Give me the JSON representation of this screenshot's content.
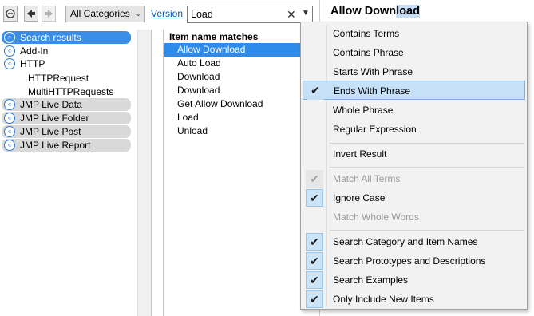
{
  "toolbar": {
    "category": "All Categories",
    "version_link": "Version",
    "search_value": "Load",
    "clear_glyph": "✕",
    "dropdown_glyph": "▼"
  },
  "tree": {
    "items": [
      {
        "label": "Search results",
        "icon": "search-icon"
      },
      {
        "label": "Add-In",
        "icon": "expand-icon"
      },
      {
        "label": "HTTP",
        "icon": "expand-icon"
      },
      {
        "label": "HTTPRequest"
      },
      {
        "label": "MultiHTTPRequests"
      },
      {
        "label": "JMP Live Data",
        "icon": "expand-icon"
      },
      {
        "label": "JMP Live Folder",
        "icon": "expand-icon"
      },
      {
        "label": "JMP Live Post",
        "icon": "expand-icon"
      },
      {
        "label": "JMP Live Report",
        "icon": "expand-icon"
      }
    ]
  },
  "list": {
    "header": "Item name matches",
    "items": [
      "Allow Download",
      "Auto Load",
      "Download",
      "Download",
      "Get Allow Download",
      "Load",
      "Unload"
    ]
  },
  "doc": {
    "title_pre": "Allow Down",
    "title_hl": "load"
  },
  "menu": {
    "items": [
      {
        "label": "Contains Terms",
        "checked": false,
        "disabled": false
      },
      {
        "label": "Contains Phrase",
        "checked": false,
        "disabled": false
      },
      {
        "label": "Starts With Phrase",
        "checked": false,
        "disabled": false
      },
      {
        "label": "Ends With Phrase",
        "checked": true,
        "disabled": false,
        "active": true
      },
      {
        "label": "Whole Phrase",
        "checked": false,
        "disabled": false
      },
      {
        "label": "Regular Expression",
        "checked": false,
        "disabled": false
      },
      {
        "label": "Invert Result",
        "checked": false,
        "disabled": false
      },
      {
        "label": "Match All Terms",
        "checked": true,
        "disabled": true
      },
      {
        "label": "Ignore Case",
        "checked": true,
        "disabled": false
      },
      {
        "label": "Match Whole Words",
        "checked": false,
        "disabled": true
      },
      {
        "label": "Search Category and Item Names",
        "checked": true,
        "disabled": false
      },
      {
        "label": "Search Prototypes and Descriptions",
        "checked": true,
        "disabled": false
      },
      {
        "label": "Search Examples",
        "checked": true,
        "disabled": false
      },
      {
        "label": "Only Include New Items",
        "checked": true,
        "disabled": false
      }
    ],
    "check_glyph": "✔"
  },
  "colors": {
    "accent": "#2f8bea",
    "menu_highlight": "#c6e0f7",
    "link": "#0a5ab8"
  }
}
